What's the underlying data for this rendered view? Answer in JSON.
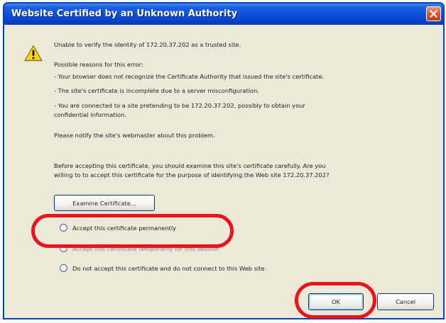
{
  "dialog": {
    "title": "Website Certified by an Unknown Authority",
    "intro": "Unable to verify the identity of 172.20.37.202 as a trusted site.",
    "reasons_heading": "Possible reasons for this error:",
    "reasons": [
      "- Your browser does not recognize the Certificate Authority that issued the site's certificate.",
      "- The site's certificate is incomplete due to a server misconfiguration.",
      "- You are connected to a site pretending to be 172.20.37.202, possibly to obtain your",
      "confidential information."
    ],
    "notify": "Please notify the site's webmaster about this problem.",
    "before_accepting": [
      "Before accepting this certificate, you should examine this site's certificate carefully. Are you",
      "willing to to accept this certificate for the purpose of identifying the Web site 172.20.37.202?"
    ],
    "examine_button": "Examine Certificate...",
    "options": [
      "Accept this certificate permanently",
      "Accept this certificate temporarily for this session",
      "Do not accept this certificate and do not connect to this Web site"
    ],
    "ok_button": "OK",
    "cancel_button": "Cancel"
  },
  "icons": {
    "warning": "warning-icon",
    "close": "close-icon"
  },
  "colors": {
    "titlebar": "#0a4ed8",
    "dialog_background": "#ece9d8",
    "highlight": "#e8141e",
    "close_button": "#d9532d"
  }
}
